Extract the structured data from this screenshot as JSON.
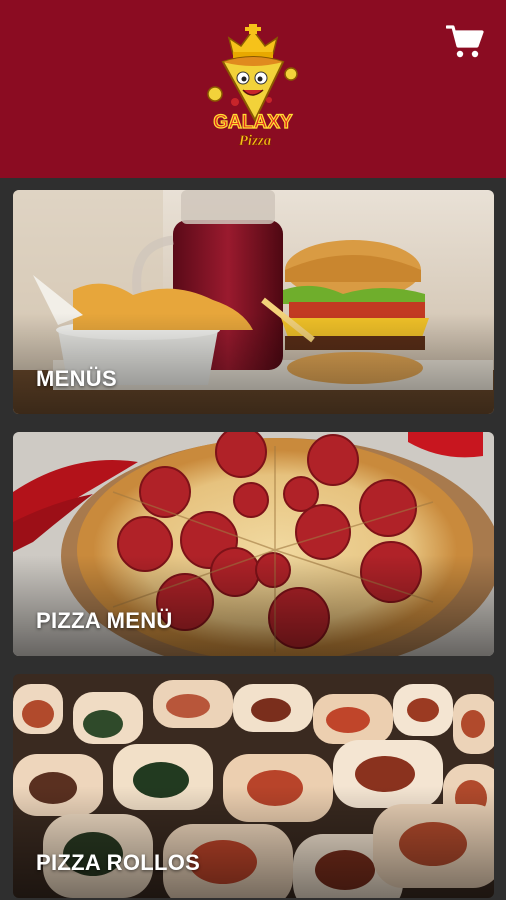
{
  "header": {
    "logo": {
      "name": "galaxy-pizza-logo",
      "text_top": "GALAXY",
      "text_bottom": "Pizza"
    },
    "cart_icon": "shopping-cart-icon",
    "background_color": "#8b0c22"
  },
  "categories": [
    {
      "label": "MENÜS",
      "image": "burger-fries-drink-photo"
    },
    {
      "label": "PIZZA MENÜ",
      "image": "pepperoni-pizza-photo"
    },
    {
      "label": "PIZZA ROLLOS",
      "image": "pizza-rolls-photo"
    }
  ],
  "colors": {
    "page_background": "#2f2f2f",
    "label_text": "#ffffff"
  }
}
